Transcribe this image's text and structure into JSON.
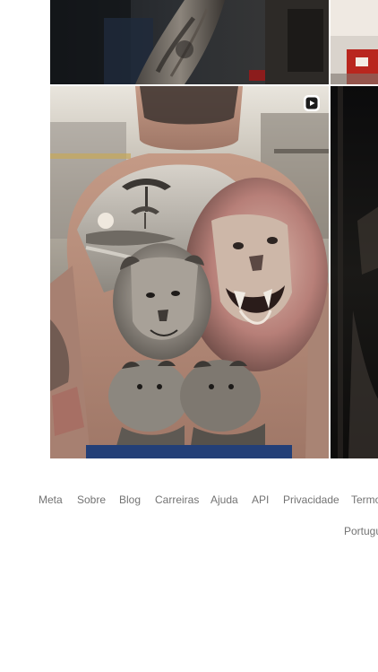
{
  "grid": {
    "posts": [
      {
        "alt": "tattoo-sleeve-post",
        "type": "image"
      },
      {
        "alt": "tattoo-post-partial",
        "type": "image"
      },
      {
        "alt": "back-piece-lion-family-post",
        "type": "reel"
      },
      {
        "alt": "dark-post-partial",
        "type": "image"
      }
    ],
    "reel_icon": "reel-play-icon"
  },
  "footer": {
    "links": [
      "Meta",
      "Sobre",
      "Blog",
      "Carreiras",
      "Ajuda",
      "API",
      "Privacidade",
      "Termos"
    ],
    "language": "Português"
  },
  "colors": {
    "footer_text": "#737373",
    "background": "#ffffff"
  }
}
